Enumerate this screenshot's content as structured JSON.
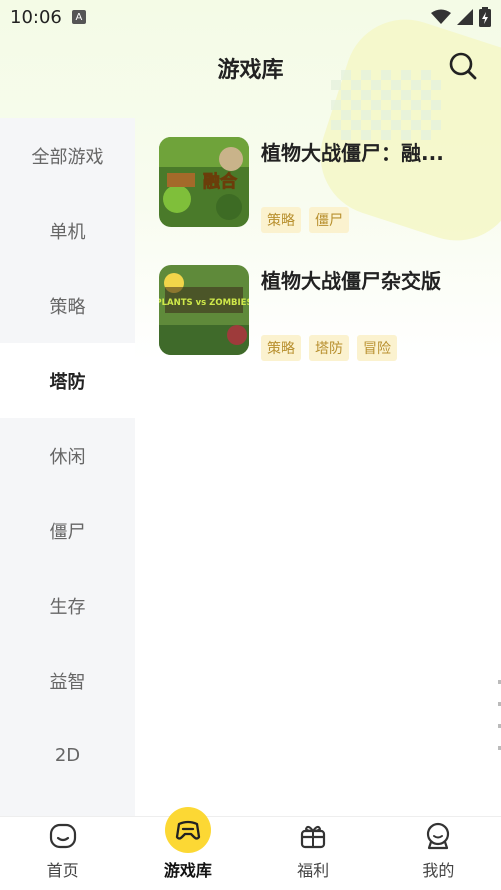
{
  "status_bar": {
    "time": "10:06",
    "notification_icon": "A"
  },
  "header": {
    "title": "游戏库"
  },
  "sidebar": {
    "items": [
      {
        "label": "全部游戏",
        "active": false
      },
      {
        "label": "单机",
        "active": false
      },
      {
        "label": "策略",
        "active": false
      },
      {
        "label": "塔防",
        "active": true
      },
      {
        "label": "休闲",
        "active": false
      },
      {
        "label": "僵尸",
        "active": false
      },
      {
        "label": "生存",
        "active": false
      },
      {
        "label": "益智",
        "active": false
      },
      {
        "label": "2D",
        "active": false
      }
    ]
  },
  "games": [
    {
      "title": "植物大战僵尸：融...",
      "tags": [
        "策略",
        "僵尸"
      ],
      "thumb_text": "融合"
    },
    {
      "title": "植物大战僵尸杂交版",
      "tags": [
        "策略",
        "塔防",
        "冒险"
      ],
      "thumb_text": "PLANTS vs ZOMBIES"
    }
  ],
  "tabbar": {
    "tabs": [
      {
        "label": "首页",
        "icon": "home-face-icon",
        "active": false
      },
      {
        "label": "游戏库",
        "icon": "gamepad-icon",
        "active": true
      },
      {
        "label": "福利",
        "icon": "gift-icon",
        "active": false
      },
      {
        "label": "我的",
        "icon": "profile-icon",
        "active": false
      }
    ]
  },
  "colors": {
    "accent": "#fcd834",
    "tag_bg": "#fbf2cf",
    "tag_text": "#b8902f",
    "sidebar_bg": "#f5f6f8"
  }
}
